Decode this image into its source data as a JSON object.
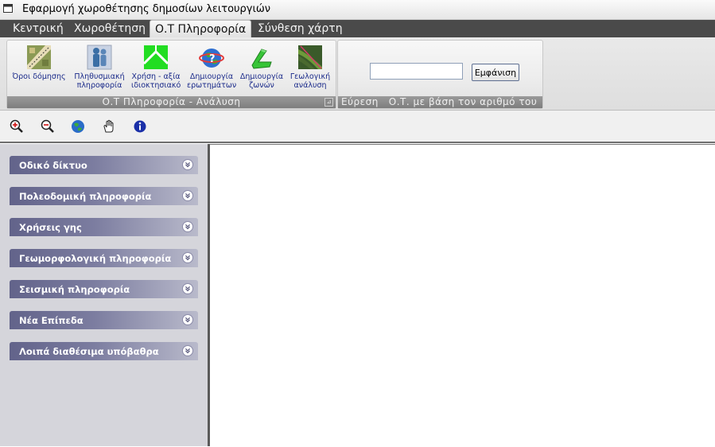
{
  "window": {
    "title": "Εφαρμογή χωροθέτησης δημοσίων λειτουργιών"
  },
  "tabs": [
    {
      "label": "Κεντρική"
    },
    {
      "label": "Χωροθέτηση"
    },
    {
      "label": "Ο.Τ Πληροφορία"
    },
    {
      "label": "Σύνθεση χάρτη"
    }
  ],
  "ribbon": {
    "analysis_group": {
      "label": "Ο.Τ Πληροφορία - Ανάλυση",
      "buttons": [
        {
          "label1": "Όροι δόμησης",
          "label2": "",
          "icon": "building-terms-icon"
        },
        {
          "label1": "Πληθυσμιακή",
          "label2": "πληροφορία",
          "icon": "population-icon"
        },
        {
          "label1": "Χρήση - αξία",
          "label2": "ιδιοκτησιακό",
          "icon": "land-use-icon"
        },
        {
          "label1": "Δημιουργία",
          "label2": "ερωτημάτων",
          "icon": "query-globe-icon"
        },
        {
          "label1": "Δημιουργία",
          "label2": "ζωνών",
          "icon": "zones-icon"
        },
        {
          "label1": "Γεωλογική",
          "label2": "ανάλυση",
          "icon": "geology-icon"
        }
      ]
    },
    "search_group": {
      "label": "Εύρεση   Ο.Τ. με βάση τον αριθμό του",
      "input_value": "",
      "button_label": "Εμφάνιση"
    }
  },
  "map_tools": [
    "zoom-in-icon",
    "zoom-out-icon",
    "globe-full-extent-icon",
    "pan-hand-icon",
    "info-icon"
  ],
  "sidebar": {
    "panes": [
      {
        "label": "Οδικό δίκτυο"
      },
      {
        "label": "Πολεοδομική πληροφορία"
      },
      {
        "label": "Χρήσεις γης"
      },
      {
        "label": "Γεωμορφολογική πληροφορία"
      },
      {
        "label": "Σεισμική πληροφορία"
      },
      {
        "label": "Νέα Επίπεδα"
      },
      {
        "label": "Λοιπά διαθέσιμα υπόβαθρα"
      }
    ]
  }
}
